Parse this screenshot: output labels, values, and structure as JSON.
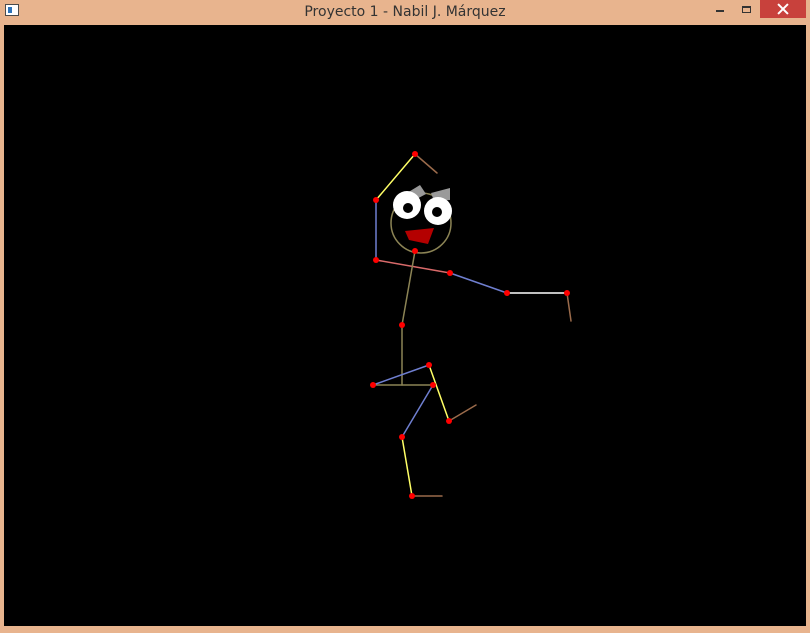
{
  "window": {
    "title": "Proyecto 1 - Nabil J. Márquez",
    "app_icon": "window-app-icon",
    "controls": {
      "minimize_icon": "minimize-icon",
      "maximize_icon": "maximize-icon",
      "close_icon": "close-icon"
    }
  },
  "scene": {
    "background": "#000000",
    "colors": {
      "joint": "#ff0000",
      "yellow": "#ffff66",
      "brown": "#9b6b4b",
      "blue": "#6f7fd0",
      "red_line": "#d96a6a",
      "olive": "#8c8455",
      "white": "#ffffff",
      "eye_black": "#000000",
      "brow": "#9a9a9a",
      "mouth": "#b40000"
    }
  }
}
